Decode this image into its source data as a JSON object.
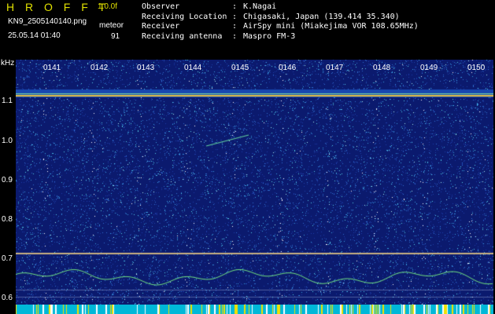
{
  "header": {
    "app_name": "H R O F F T",
    "version": "1.0.0f",
    "filename": "KN9_2505140140.png",
    "mode": "meteor",
    "timestamp": "25.05.14 01:40",
    "count": "91"
  },
  "info": [
    {
      "key": "Observer",
      "colon": ":",
      "value": "K.Nagai"
    },
    {
      "key": "Receiving Location",
      "colon": ":",
      "value": "Chigasaki, Japan (139.414 35.340)"
    },
    {
      "key": "Receiver",
      "colon": ":",
      "value": "AirSpy mini (Miakejima VOR 108.65MHz)"
    },
    {
      "key": "Receiving antenna",
      "colon": ":",
      "value": "Maspro FM-3"
    }
  ],
  "axis": {
    "unit": "kHz",
    "y_ticks": [
      "1.1",
      "1.0",
      "0.9",
      "0.8",
      "0.7",
      "0.6"
    ],
    "time_ticks": [
      "0141",
      "0142",
      "0143",
      "0144",
      "0145",
      "0146",
      "0147",
      "0148",
      "0149",
      "0150"
    ]
  },
  "colors": {
    "background": "#0b1a6e",
    "noise": [
      "#1e3ca8",
      "#2f6fd0",
      "#38a0e0",
      "#55d0e8",
      "#a8f0f0",
      "#ffffff"
    ],
    "carrier_upper": "#e8c040",
    "carrier_lower": "#c8b080",
    "bottom_bar": "#00b8d8"
  }
}
